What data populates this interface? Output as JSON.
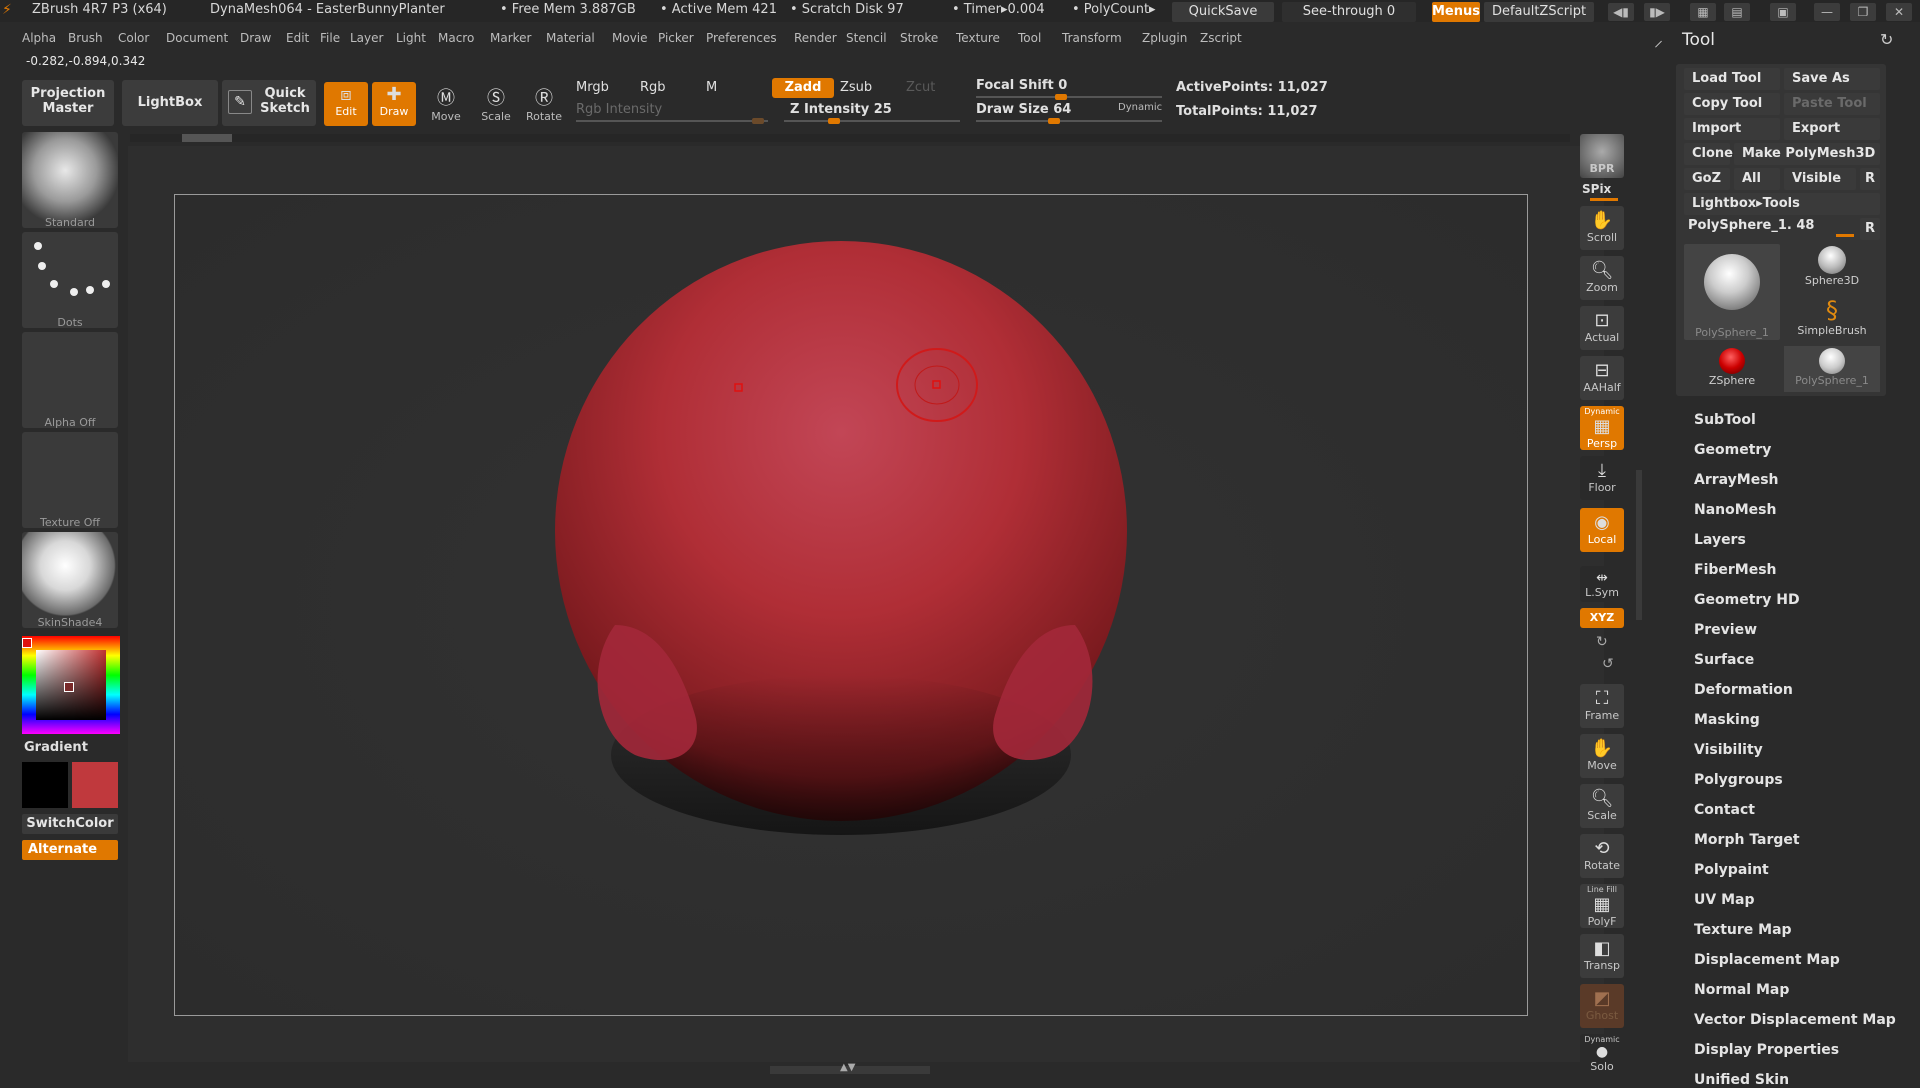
{
  "titlebar": {
    "app": "ZBrush 4R7 P3 (x64)",
    "document": "DynaMesh064 - EasterBunnyPlanter",
    "free_mem": "• Free Mem 3.887GB",
    "active_mem": "• Active Mem 421",
    "scratch": "• Scratch Disk 97",
    "timer": "• Timer▸0.004",
    "polycount": "• PolyCount▸",
    "quicksave": "QuickSave",
    "see_through": "See-through 0",
    "menus": "Menus",
    "script": "DefaultZScript"
  },
  "menubar": [
    "Alpha",
    "Brush",
    "Color",
    "Document",
    "Draw",
    "Edit",
    "File",
    "Layer",
    "Light",
    "Macro",
    "Marker",
    "Material",
    "Movie",
    "Picker",
    "Preferences",
    "Render",
    "Stencil",
    "Stroke",
    "Texture",
    "Tool",
    "Transform",
    "Zplugin",
    "Zscript"
  ],
  "coords": "-0.282,-0.894,0.342",
  "shelf": {
    "projection_master": "Projection Master",
    "lightbox": "LightBox",
    "quick_sketch": "Quick Sketch",
    "edit": "Edit",
    "draw": "Draw",
    "move": "Move",
    "scale": "Scale",
    "rotate": "Rotate",
    "mrgb": "Mrgb",
    "rgb": "Rgb",
    "m": "M",
    "rgb_intensity": "Rgb Intensity",
    "zadd": "Zadd",
    "zsub": "Zsub",
    "zcut": "Zcut",
    "z_intensity": "Z Intensity 25",
    "focal_shift": "Focal Shift 0",
    "draw_size": "Draw Size 64",
    "dynamic": "Dynamic",
    "active_points": "ActivePoints: 11,027",
    "total_points": "TotalPoints: 11,027",
    "z_intensity_value": 25,
    "focal_shift_value": 0,
    "draw_size_value": 64
  },
  "left": {
    "brush": "Standard",
    "stroke": "Dots",
    "alpha": "Alpha Off",
    "texture": "Texture Off",
    "material": "SkinShade4",
    "gradient": "Gradient",
    "switch_color": "SwitchColor",
    "alternate": "Alternate",
    "main_color": "#c0393d",
    "secondary_color": "#000000"
  },
  "right_shelf": [
    "BPR",
    "SPix",
    "Scroll",
    "Zoom",
    "Actual",
    "AAHalf",
    "Persp",
    "Floor",
    "Local",
    "L.Sym",
    "XYZ",
    "Frame",
    "Move",
    "Scale",
    "Rotate",
    "PolyF",
    "Transp",
    "Ghost",
    "Solo"
  ],
  "right_shelf_extra": {
    "dynamic": "Dynamic",
    "line_fill": "Line Fill"
  },
  "tool_panel": {
    "title": "Tool",
    "load_tool": "Load Tool",
    "save_as": "Save As",
    "copy_tool": "Copy Tool",
    "paste_tool": "Paste Tool",
    "import": "Import",
    "export": "Export",
    "clone": "Clone",
    "make_polymesh": "Make PolyMesh3D",
    "goz": "GoZ",
    "all": "All",
    "visible": "Visible",
    "r": "R",
    "lightbox_tools": "Lightbox▸Tools",
    "current_tool": "PolySphere_1. 48",
    "tools": [
      "PolySphere_1",
      "Sphere3D",
      "SimpleBrush",
      "ZSphere",
      "PolySphere_1"
    ],
    "subpalettes": [
      "SubTool",
      "Geometry",
      "ArrayMesh",
      "NanoMesh",
      "Layers",
      "FiberMesh",
      "Geometry HD",
      "Preview",
      "Surface",
      "Deformation",
      "Masking",
      "Visibility",
      "Polygroups",
      "Contact",
      "Morph Target",
      "Polypaint",
      "UV Map",
      "Texture Map",
      "Displacement Map",
      "Normal Map",
      "Vector Displacement Map",
      "Display Properties",
      "Unified Skin"
    ]
  },
  "colors": {
    "accent": "#e07800",
    "mesh": "#c0393d"
  }
}
